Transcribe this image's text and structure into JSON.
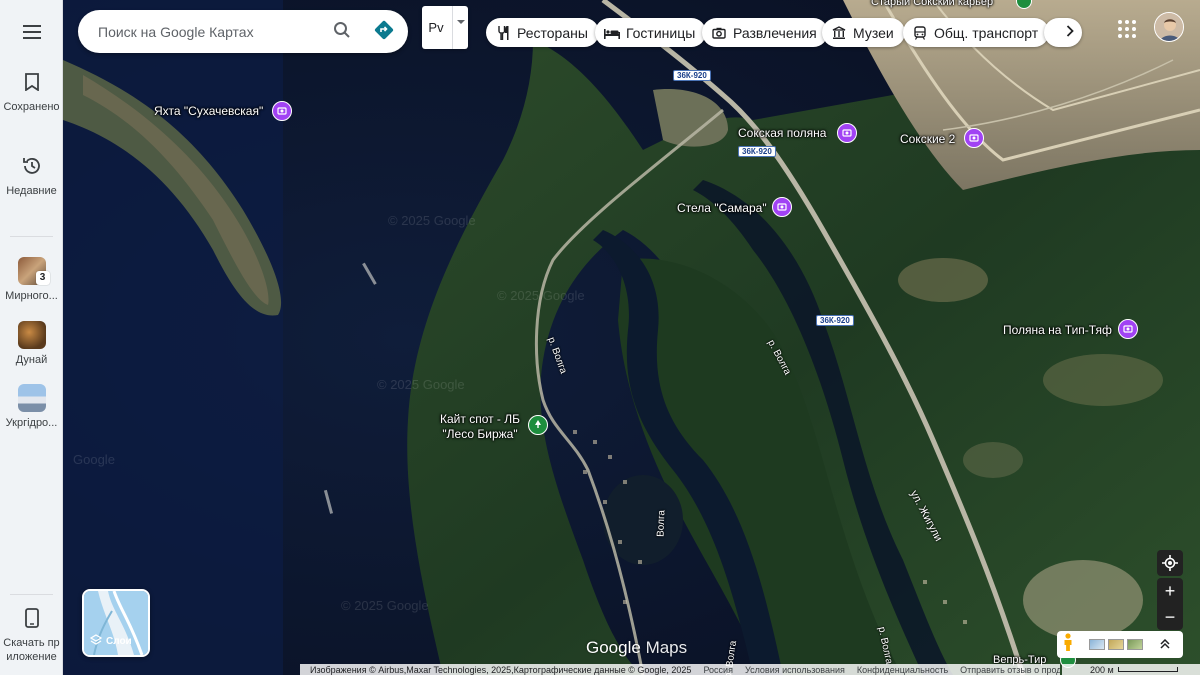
{
  "sidebar": {
    "saved_label": "Сохранено",
    "recent_label": "Недавние",
    "items": [
      {
        "label": "Мирного...",
        "badge": "3"
      },
      {
        "label": "Дунай"
      },
      {
        "label": "Укргідро..."
      }
    ],
    "install_label": "Скачать приложение"
  },
  "search": {
    "placeholder": "Поиск на Google Картах"
  },
  "language": {
    "value": "Рv"
  },
  "chips": [
    {
      "label": "Рестораны",
      "icon": "fork-knife-icon"
    },
    {
      "label": "Гостиницы",
      "icon": "bed-icon"
    },
    {
      "label": "Развлечения",
      "icon": "camera-icon"
    },
    {
      "label": "Музеи",
      "icon": "museum-icon"
    },
    {
      "label": "Общ. транспорт",
      "icon": "transit-icon"
    }
  ],
  "layers": {
    "label": "Слои"
  },
  "places": [
    {
      "name": "Яхта \"Сухачевская\"",
      "type": "attraction"
    },
    {
      "name": "Сокская поляна",
      "type": "attraction"
    },
    {
      "name": "Сокские 2",
      "type": "attraction"
    },
    {
      "name": "Стела \"Самара\"",
      "type": "attraction"
    },
    {
      "name": "Поляна на Тип-Тяф",
      "type": "attraction"
    },
    {
      "name": "Кайт спот - ЛБ",
      "name2": "\"Лесо Биржа\"",
      "type": "park"
    },
    {
      "name": "Старый Сокский карьер",
      "type": "park"
    },
    {
      "name": "Вепрь-Тир",
      "type": "park"
    }
  ],
  "roads": {
    "shield": "36К-920",
    "street": "ул. Жигули",
    "river1": "р. Волга",
    "river2": "р. Волга",
    "river3": "Волга",
    "river4": "р. Волга",
    "river5": "р. Волга"
  },
  "watermarks": {
    "a": "© 2025 Google",
    "b": "© 2025 Google",
    "c": "© 2025 Google",
    "d": "Google",
    "e": "© 2025 Google"
  },
  "brand": {
    "google": "Google",
    "maps": "Maps"
  },
  "footer": {
    "imagery": "Изображения © Airbus,Maxar Technologies, 2025,Картографические данные © Google, 2025",
    "country": "Россия",
    "terms": "Условия использования",
    "privacy": "Конфиденциальность",
    "feedback": "Отправить отзыв о продукте",
    "scale": "200 м"
  },
  "colors": {
    "attraction_pin": "#a142f4",
    "park_pin": "#1e8e3e",
    "directions": "#1a73e8"
  }
}
